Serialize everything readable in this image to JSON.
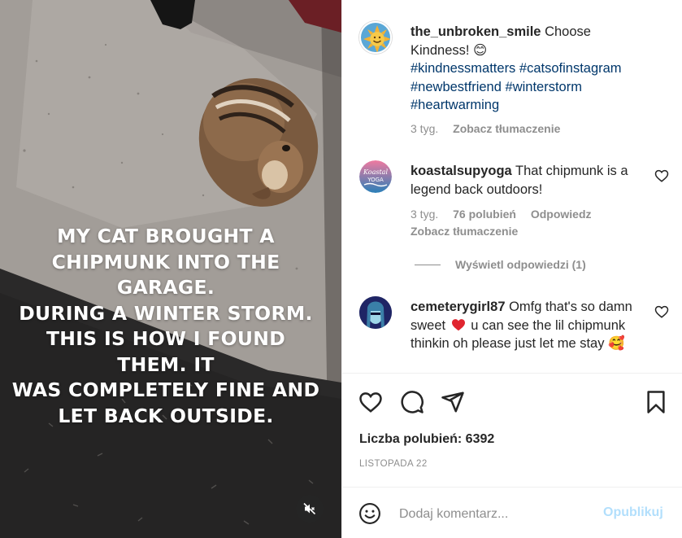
{
  "post": {
    "caption_overlay": "MY CAT BROUGHT A\nCHIPMUNK INTO THE GARAGE.\nDURING A WINTER STORM.\nTHIS IS HOW I FOUND THEM. IT\nWAS COMPLETELY FINE AND\nLET BACK OUTSIDE.",
    "mute_icon": "speaker-muted-icon"
  },
  "author_comment": {
    "username": "the_unbroken_smile",
    "text": "Choose Kindness! 😊",
    "hashtags": [
      "#kindnessmatters",
      "#catsofinstagram",
      "#newbestfriend",
      "#winterstorm",
      "#heartwarming"
    ],
    "time": "3 tyg.",
    "translate": "Zobacz tłumaczenie"
  },
  "comments": [
    {
      "username": "koastalsupyoga",
      "text": "That chipmunk is a legend back outdoors!",
      "time": "3 tyg.",
      "likes": "76 polubień",
      "reply": "Odpowiedz",
      "translate": "Zobacz tłumaczenie",
      "avatar_text": "Koastal YOGA"
    },
    {
      "username": "cemeterygirl87",
      "text_a": "Omfg that's so damn sweet",
      "text_b": "u can see the lil chipmunk thinkin oh please just let me stay",
      "emoji": "🥰"
    }
  ],
  "view_replies": "Wyświetl odpowiedzi (1)",
  "actions": {
    "like_icon": "heart-icon",
    "comment_icon": "comment-icon",
    "share_icon": "share-icon",
    "save_icon": "bookmark-icon"
  },
  "likes_label": "Liczba polubień: 6392",
  "date": "LISTOPADA 22",
  "add_comment": {
    "placeholder": "Dodaj komentarz...",
    "post_label": "Opublikuj",
    "emoji_icon": "smiley-icon"
  },
  "colors": {
    "link": "#00376b",
    "muted": "#8e8e8e",
    "post_disabled": "#b2dffc",
    "heart_red": "#ed4956"
  }
}
